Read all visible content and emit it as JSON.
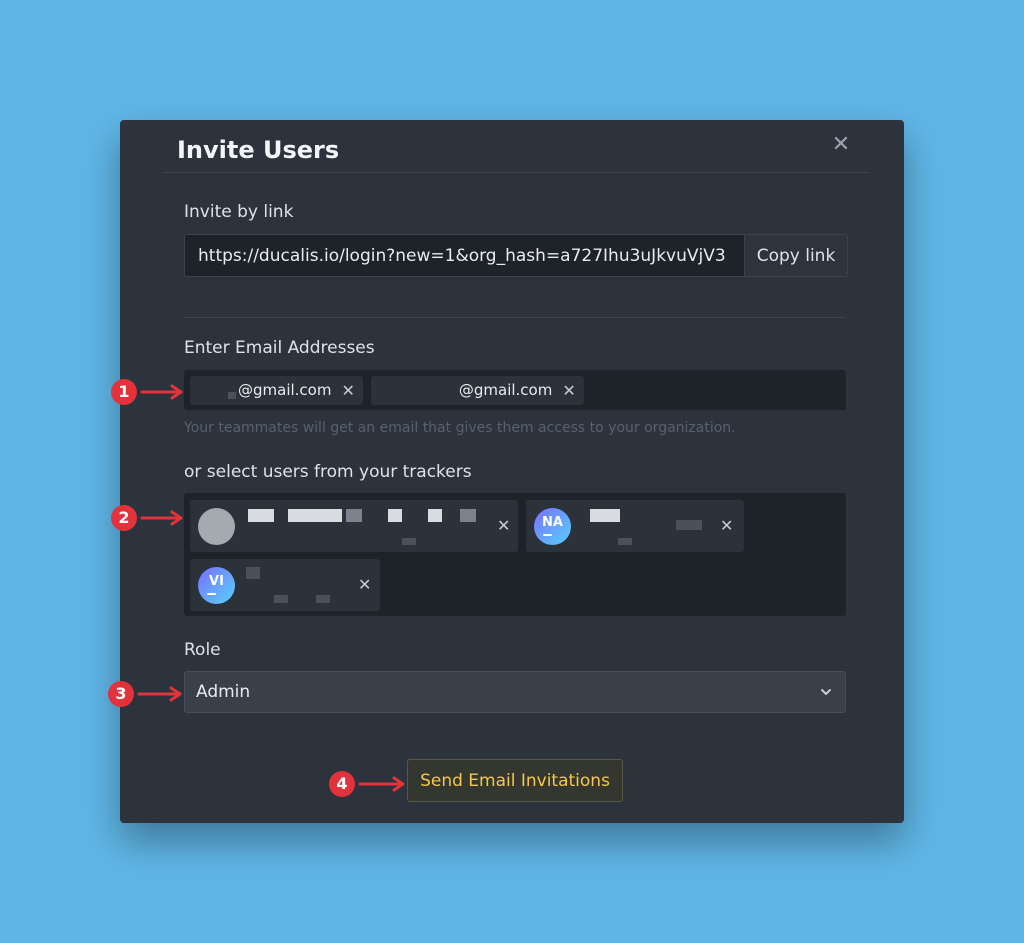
{
  "dialog": {
    "title": "Invite Users",
    "close_icon": "close-icon"
  },
  "invite_link": {
    "label": "Invite by link",
    "url": "https://ducalis.io/login?new=1&org_hash=a727Ihu3uJkvuVjV3",
    "copy_label": "Copy link"
  },
  "emails": {
    "label": "Enter Email Addresses",
    "chips": [
      {
        "suffix": "@gmail.com"
      },
      {
        "suffix": "@gmail.com"
      }
    ],
    "helper": "Your teammates will get an email that gives them access to your organization."
  },
  "trackers": {
    "label": "or select users from your trackers",
    "users": [
      {
        "initials": ""
      },
      {
        "initials": "NA"
      },
      {
        "initials": "VI"
      }
    ]
  },
  "role": {
    "label": "Role",
    "selected": "Admin"
  },
  "actions": {
    "send_label": "Send Email Invitations"
  },
  "annotations": {
    "markers": [
      "1",
      "2",
      "3",
      "4"
    ],
    "marker_color": "#e2323b"
  },
  "colors": {
    "background": "#5fb6e6",
    "modal": "#2d333c",
    "accent": "#f4c94a"
  }
}
